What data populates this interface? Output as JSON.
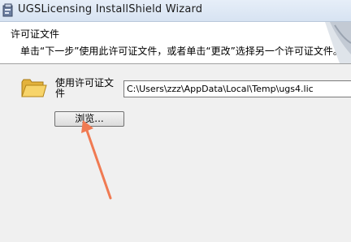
{
  "window": {
    "title": "UGSLicensing InstallShield Wizard",
    "icon": "installer-icon"
  },
  "header": {
    "title": "许可证文件",
    "subtitle": "单击“下一步”使用此许可证文件，或者单击“更改”选择另一个许可证文件。"
  },
  "license": {
    "label": "使用许可证文件",
    "path_value": "C:\\Users\\zzz\\AppData\\Local\\Temp\\ugs4.lic",
    "browse_label": "浏览..."
  },
  "annotation": {
    "arrow_color": "#f07a52"
  }
}
